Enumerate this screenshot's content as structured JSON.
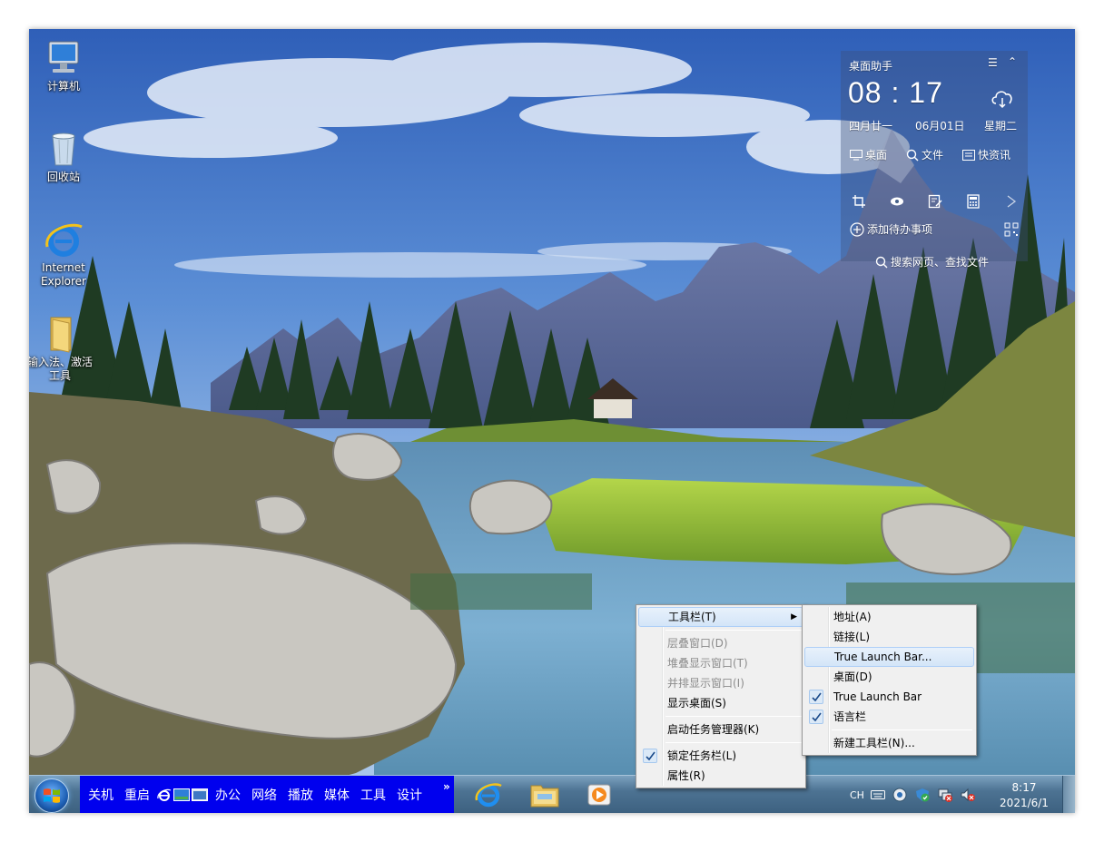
{
  "desktop": {
    "icons": [
      {
        "label": "计算机"
      },
      {
        "label": "回收站"
      },
      {
        "label_line1": "Internet",
        "label_line2": "Explorer"
      },
      {
        "label_line1": "输入法、激活",
        "label_line2": "工具"
      }
    ]
  },
  "widget": {
    "title": "桌面助手",
    "time": "08 : 17",
    "lunar_date": "四月廿一",
    "date": "06月01日",
    "weekday": "星期二",
    "links": [
      "桌面",
      "文件",
      "快资讯"
    ],
    "todo_label": "添加待办事项",
    "search_label": "搜索网页、查找文件"
  },
  "taskbar": {
    "quick_launch": [
      "关机",
      "重启",
      "办公",
      "网络",
      "播放",
      "媒体",
      "工具",
      "设计"
    ],
    "overflow_chevron": "»",
    "tray": {
      "lang": "CH"
    },
    "clock": {
      "time": "8:17",
      "date": "2021/6/1"
    }
  },
  "context_menu": {
    "items": [
      {
        "label": "工具栏(T)",
        "state": "highlighted",
        "submenu": true
      },
      {
        "label": "层叠窗口(D)",
        "state": "disabled"
      },
      {
        "label": "堆叠显示窗口(T)",
        "state": "disabled"
      },
      {
        "label": "并排显示窗口(I)",
        "state": "disabled"
      },
      {
        "label": "显示桌面(S)",
        "state": "normal"
      },
      {
        "label": "启动任务管理器(K)",
        "state": "normal"
      },
      {
        "label": "锁定任务栏(L)",
        "state": "checked"
      },
      {
        "label": "属性(R)",
        "state": "normal"
      }
    ]
  },
  "toolbars_submenu": {
    "items": [
      {
        "label": "地址(A)",
        "checked": false
      },
      {
        "label": "链接(L)",
        "checked": false
      },
      {
        "label": "True Launch Bar...",
        "checked": false,
        "highlighted": true
      },
      {
        "label": "桌面(D)",
        "checked": false
      },
      {
        "label": "True Launch Bar",
        "checked": true
      },
      {
        "label": "语言栏",
        "checked": true
      },
      {
        "label": "新建工具栏(N)...",
        "checked": false
      }
    ]
  },
  "colors": {
    "quick_launch_bg": "#0000ee",
    "menu_bg": "#f0f0f0",
    "menu_highlight": "#d3e5f8"
  }
}
